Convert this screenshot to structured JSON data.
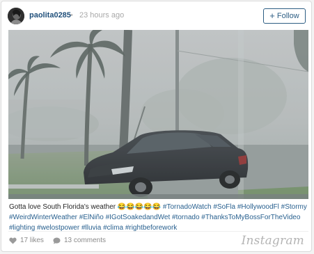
{
  "post": {
    "username": "paolita0285",
    "separator": "•",
    "timestamp": "23 hours ago",
    "follow_label": "Follow",
    "follow_symbol": "+"
  },
  "caption": {
    "lead": "Gotta love South Florida's weather 😂😂😂😂😂 ",
    "hashtags": [
      "#TornadoWatch",
      "#SoFla",
      "#HollywoodFl",
      "#Stormy",
      "#WeirdWinterWeather",
      "#ElNiño",
      "#IGotSoakedandWet",
      "#tornado",
      "#ThanksToMyBossForTheVideo",
      "#lighting",
      "#welostpower",
      "#lluvia",
      "#clima",
      "#rightbeforework"
    ]
  },
  "stats": {
    "likes": "17 likes",
    "comments": "13 comments"
  },
  "brand": "Instagram",
  "colors": {
    "link": "#275f8e",
    "username": "#1f4f7a",
    "follow_border": "#2c5d83",
    "muted": "#8a8a8a"
  },
  "icons": [
    "avatar",
    "plus-icon",
    "heart-icon",
    "comment-icon"
  ]
}
